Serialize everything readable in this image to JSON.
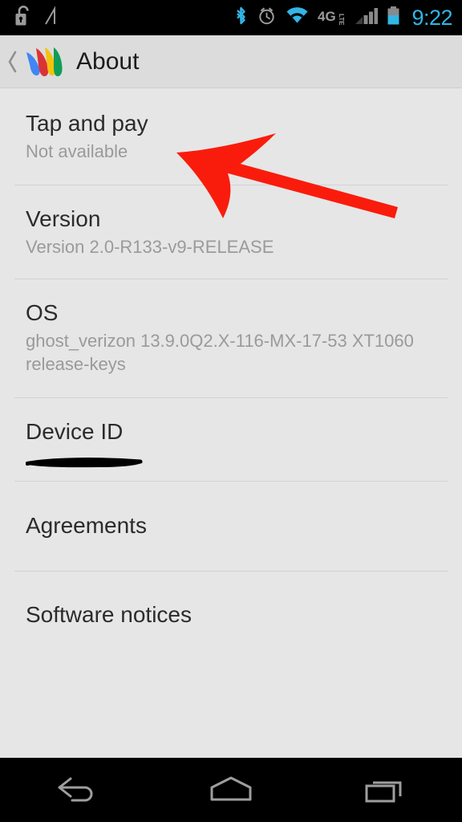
{
  "status_bar": {
    "left_icons": [
      "unlocked-padlock-icon",
      "slash-indicator-icon"
    ],
    "right_icons": [
      "bluetooth-icon",
      "alarm-clock-icon",
      "wifi-icon",
      "4g-lte-icon",
      "signal-bars-icon",
      "battery-icon"
    ],
    "network_label": "4G",
    "network_sublabel": "LTE",
    "clock": "9:22",
    "accent_color": "#33b5e5",
    "icon_color": "#9a9a9a",
    "background": "#000000"
  },
  "action_bar": {
    "back_icon": "back-chevron-icon",
    "app_icon": "google-wallet-logo",
    "title": "About",
    "background": "#dcdcdc",
    "logo_colors": {
      "blue": "#4285f4",
      "red": "#db3236",
      "yellow": "#f4c20d",
      "green": "#0f9d58"
    }
  },
  "list": {
    "items": [
      {
        "title": "Tap and pay",
        "subtitle": "Not available"
      },
      {
        "title": "Version",
        "subtitle": "Version 2.0-R133-v9-RELEASE"
      },
      {
        "title": "OS",
        "subtitle": "ghost_verizon 13.9.0Q2.X-116-MX-17-53 XT1060 release-keys"
      },
      {
        "title": "Device ID",
        "subtitle": "",
        "redacted": true
      },
      {
        "title": "Agreements",
        "subtitle": ""
      },
      {
        "title": "Software notices",
        "subtitle": ""
      }
    ],
    "title_color": "#2b2b2b",
    "subtitle_color": "#9a9a9a",
    "divider_color": "#d2d2d2",
    "background": "#e6e6e6"
  },
  "annotation": {
    "type": "arrow",
    "color": "#f91c0c",
    "points_to": "Tap and pay"
  },
  "nav_bar": {
    "buttons": [
      "back-nav-icon",
      "home-nav-icon",
      "recents-nav-icon"
    ],
    "icon_color": "#9e9e9e",
    "background": "#000000"
  }
}
